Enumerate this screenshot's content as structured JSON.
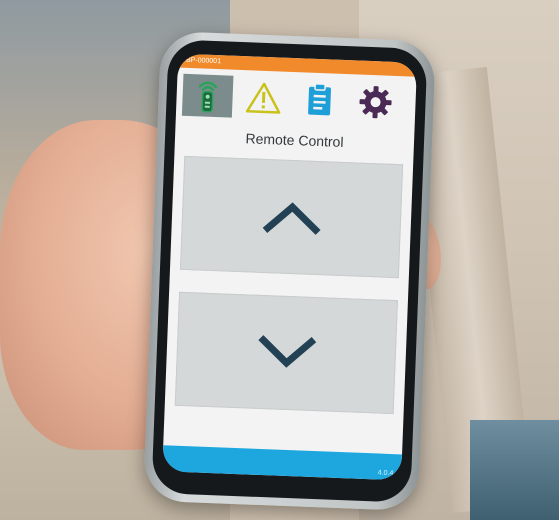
{
  "app": {
    "device_id": "BP-000001",
    "screen_title": "Remote Control",
    "version": "4.0.4"
  },
  "nav": {
    "tabs": [
      {
        "name": "remote-icon",
        "active": true
      },
      {
        "name": "warning-icon",
        "active": false
      },
      {
        "name": "clipboard-icon",
        "active": false
      },
      {
        "name": "gear-icon",
        "active": false
      }
    ]
  },
  "buttons": {
    "up": {
      "icon": "chevron-up-icon"
    },
    "down": {
      "icon": "chevron-down-icon"
    }
  },
  "colors": {
    "status_bar": "#f08a2a",
    "nav_active": "#7c8c8c",
    "remote_green": "#2aa35a",
    "warning_yellow": "#c9c21b",
    "clipboard_blue": "#1f9fd8",
    "gear_purple": "#4b2b55",
    "chevron": "#234155",
    "bottom_bar": "#1ea7df"
  }
}
